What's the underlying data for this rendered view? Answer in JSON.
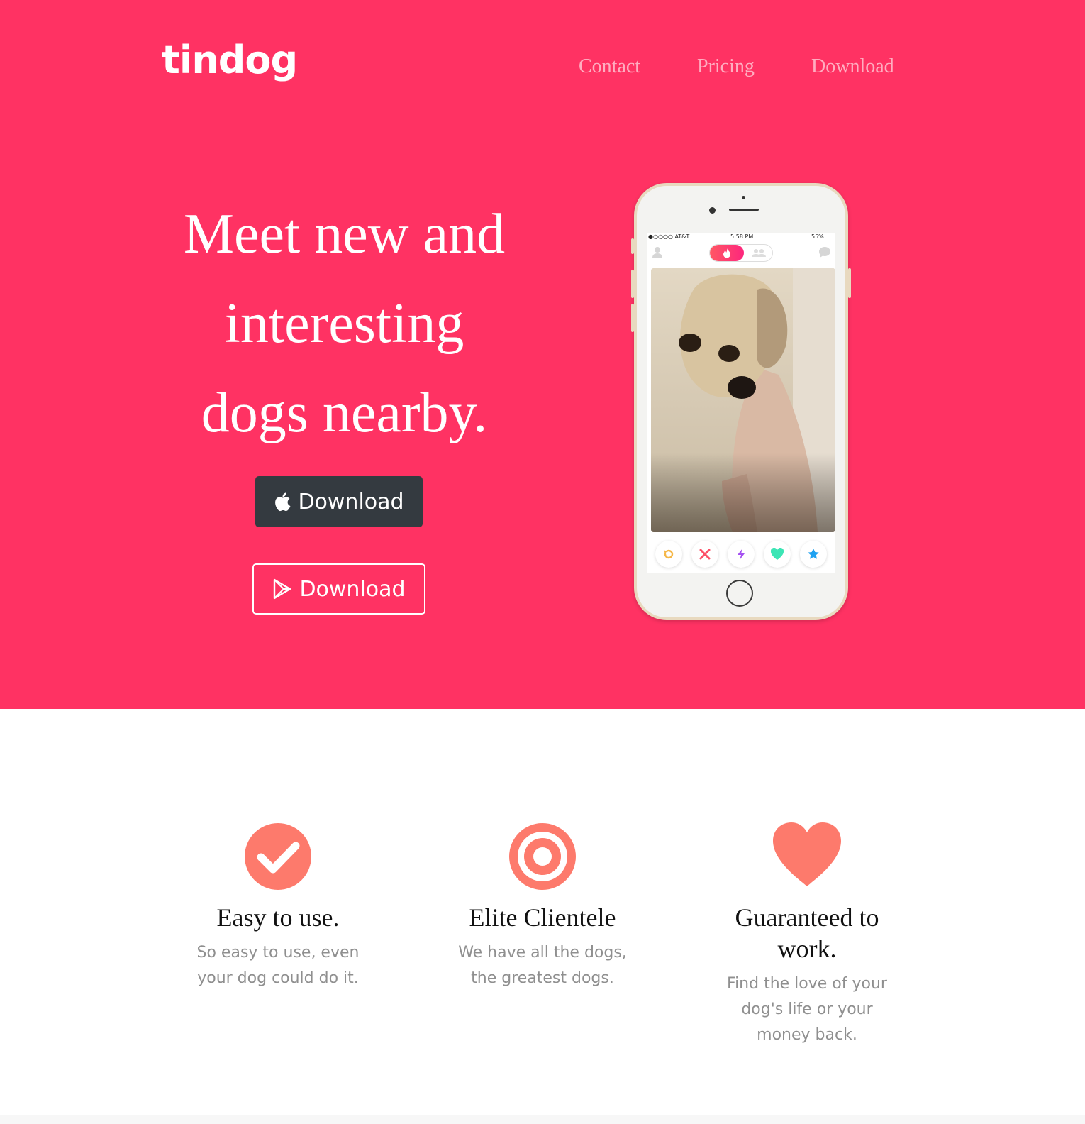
{
  "brand": {
    "logo_text": "tindog",
    "primary_color": "#ff3263",
    "accent_color": "#fd7a6c"
  },
  "nav": {
    "items": [
      {
        "label": "Contact"
      },
      {
        "label": "Pricing"
      },
      {
        "label": "Download"
      }
    ]
  },
  "hero": {
    "headline_lines": [
      "Meet new and",
      "interesting",
      "dogs nearby."
    ],
    "buttons": [
      {
        "label": "Download",
        "icon": "apple-icon",
        "style": "dark"
      },
      {
        "label": "Download",
        "icon": "google-play-icon",
        "style": "outline"
      }
    ]
  },
  "phone": {
    "status_carrier": "●○○○○ AT&T",
    "status_time": "5:58 PM",
    "status_battery": "55%",
    "action_icons": [
      "rewind-icon",
      "nope-icon",
      "boost-icon",
      "like-icon",
      "super-like-icon"
    ]
  },
  "features": [
    {
      "icon": "check-circle-icon",
      "title": "Easy to use.",
      "text": "So easy to use, even your dog could do it."
    },
    {
      "icon": "bullseye-icon",
      "title": "Elite Clientele",
      "text": "We have all the dogs, the greatest dogs."
    },
    {
      "icon": "heart-icon",
      "title": "Guaranteed to work.",
      "text": "Find the love of your dog's life or your money back."
    }
  ]
}
